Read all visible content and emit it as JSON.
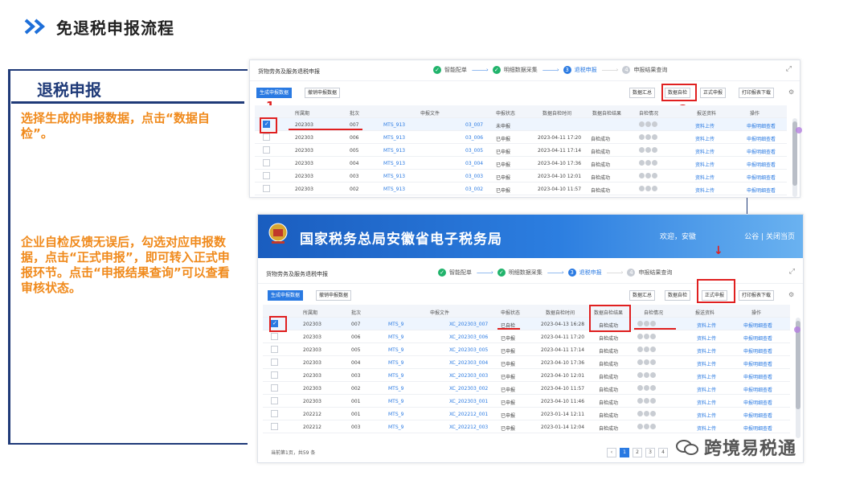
{
  "header": {
    "title": "免退税申报流程"
  },
  "left_panel": {
    "title": "退税申报",
    "instruction_1": "选择生成的申报数据，点击“数据自检”。",
    "instruction_2": "企业自检反馈无误后，勾选对应申报数据，点击“正式申报”，即可转入正式申报环节。点击“申报结果查询”可以查看审核状态。"
  },
  "portal": {
    "banner_title": "国家税务总局安徽省电子税务局",
    "welcome": "欢迎，安徽",
    "links": "公谷 | 关闭当页"
  },
  "module": {
    "title": "货物劳务及服务退税申报",
    "steps": [
      {
        "label": "智能配单",
        "state": "done"
      },
      {
        "label": "明细数据采集",
        "state": "done"
      },
      {
        "label": "退税申报",
        "num": "3",
        "state": "current"
      },
      {
        "label": "申报结果查询",
        "num": "4",
        "state": "todo"
      }
    ]
  },
  "toolbar": {
    "generate": "生成申报数据",
    "revoke": "撤销申报数据",
    "summary": "数据汇总",
    "selfcheck": "数据自检",
    "formal": "正式申报",
    "print": "打印报表下载"
  },
  "markers": {
    "one": "1",
    "two": "2"
  },
  "table": {
    "columns": [
      "所属期",
      "批次",
      "申报文件",
      "申报状态",
      "数据自检时间",
      "数据自检结果",
      "自检情况",
      "报送资料",
      "操作"
    ],
    "upload_label": "资料上传",
    "action_label": "申报明细查看",
    "rows_1": [
      {
        "period": "202303",
        "batch": "007",
        "file_a": "MTS_913",
        "file_b": "03_007",
        "status": "未申报",
        "time": "",
        "result": ""
      },
      {
        "period": "202303",
        "batch": "006",
        "file_a": "MTS_913",
        "file_b": "03_006",
        "status": "已申报",
        "time": "2023-04-11 17:20",
        "result": "自检成功"
      },
      {
        "period": "202303",
        "batch": "005",
        "file_a": "MTS_913",
        "file_b": "03_005",
        "status": "已申报",
        "time": "2023-04-11 17:14",
        "result": "自检成功"
      },
      {
        "period": "202303",
        "batch": "004",
        "file_a": "MTS_913",
        "file_b": "03_004",
        "status": "已申报",
        "time": "2023-04-10 17:36",
        "result": "自检成功"
      },
      {
        "period": "202303",
        "batch": "003",
        "file_a": "MTS_913",
        "file_b": "03_003",
        "status": "已申报",
        "time": "2023-04-10 12:01",
        "result": "自检成功"
      },
      {
        "period": "202303",
        "batch": "002",
        "file_a": "MTS_913",
        "file_b": "03_002",
        "status": "已申报",
        "time": "2023-04-10 11:57",
        "result": "自检成功"
      }
    ],
    "rows_2": [
      {
        "period": "202303",
        "batch": "007",
        "file_a": "MTS_9",
        "file_b": "XC_202303_007",
        "status": "已自检",
        "time": "2023-04-13 16:28",
        "result": "自检成功"
      },
      {
        "period": "202303",
        "batch": "006",
        "file_a": "MTS_9",
        "file_b": "XC_202303_006",
        "status": "已申报",
        "time": "2023-04-11 17:20",
        "result": "自检成功"
      },
      {
        "period": "202303",
        "batch": "005",
        "file_a": "MTS_9",
        "file_b": "XC_202303_005",
        "status": "已申报",
        "time": "2023-04-11 17:14",
        "result": "自检成功"
      },
      {
        "period": "202303",
        "batch": "004",
        "file_a": "MTS_9",
        "file_b": "XC_202303_004",
        "status": "已申报",
        "time": "2023-04-10 17:36",
        "result": "自检成功"
      },
      {
        "period": "202303",
        "batch": "003",
        "file_a": "MTS_9",
        "file_b": "XC_202303_003",
        "status": "已申报",
        "time": "2023-04-10 12:01",
        "result": "自检成功"
      },
      {
        "period": "202303",
        "batch": "002",
        "file_a": "MTS_9",
        "file_b": "XC_202303_002",
        "status": "已申报",
        "time": "2023-04-10 11:57",
        "result": "自检成功"
      },
      {
        "period": "202303",
        "batch": "001",
        "file_a": "MTS_9",
        "file_b": "XC_202303_001",
        "status": "已申报",
        "time": "2023-04-10 11:46",
        "result": "自检成功"
      },
      {
        "period": "202212",
        "batch": "001",
        "file_a": "MTS_9",
        "file_b": "XC_202212_001",
        "status": "已申报",
        "time": "2023-01-14 12:11",
        "result": "自检成功"
      },
      {
        "period": "202212",
        "batch": "003",
        "file_a": "MTS_9",
        "file_b": "XC_202212_003",
        "status": "已申报",
        "time": "2023-01-14 12:04",
        "result": "自检成功"
      }
    ]
  },
  "pagination": {
    "info": "当前第1页，共59 条",
    "pages": [
      "1",
      "2",
      "3",
      "4"
    ]
  },
  "watermark": {
    "text": "跨境易税通"
  },
  "colors": {
    "accent": "#2a7ae2",
    "brand_navy": "#1f3a78",
    "highlight": "#e02020",
    "instruction": "#f08a1c",
    "success": "#20b36b"
  }
}
